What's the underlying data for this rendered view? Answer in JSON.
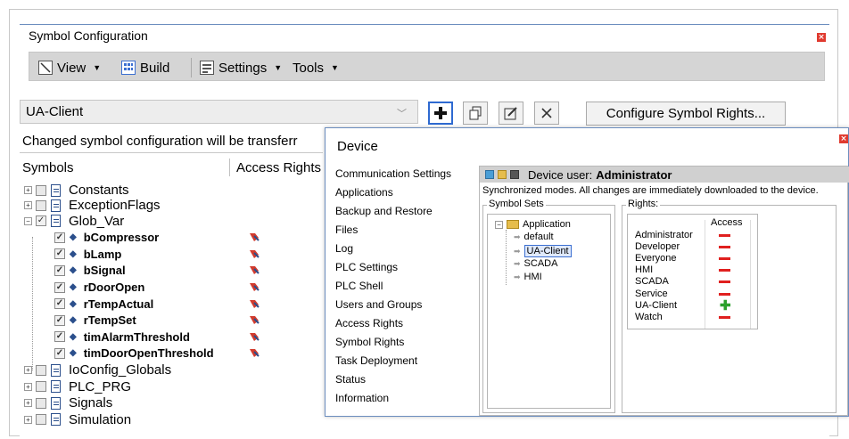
{
  "symbol_config": {
    "title": "Symbol Configuration",
    "toolbar": {
      "view_label": "View",
      "build_label": "Build",
      "settings_label": "Settings",
      "tools_label": "Tools"
    },
    "application_select": {
      "value": "UA-Client"
    },
    "buttons": {
      "configure_rights_label": "Configure Symbol Rights..."
    },
    "info_text": "Changed symbol configuration will be transferr",
    "columns": {
      "symbols": "Symbols",
      "access_rights": "Access Rights"
    },
    "tree": [
      {
        "label": "Constants",
        "level": 0,
        "expanded": false,
        "checked": false
      },
      {
        "label": "ExceptionFlags",
        "level": 0,
        "expanded": false,
        "checked": false
      },
      {
        "label": "Glob_Var",
        "level": 0,
        "expanded": true,
        "checked": true
      },
      {
        "label": "bCompressor",
        "level": 1,
        "checked": true
      },
      {
        "label": "bLamp",
        "level": 1,
        "checked": true
      },
      {
        "label": "bSignal",
        "level": 1,
        "checked": true
      },
      {
        "label": "rDoorOpen",
        "level": 1,
        "checked": true
      },
      {
        "label": "rTempActual",
        "level": 1,
        "checked": true
      },
      {
        "label": "rTempSet",
        "level": 1,
        "checked": true
      },
      {
        "label": "timAlarmThreshold",
        "level": 1,
        "checked": true
      },
      {
        "label": "timDoorOpenThreshold",
        "level": 1,
        "checked": true
      },
      {
        "label": "IoConfig_Globals",
        "level": 0,
        "expanded": false,
        "checked": false
      },
      {
        "label": "PLC_PRG",
        "level": 0,
        "expanded": false,
        "checked": false
      },
      {
        "label": "Signals",
        "level": 0,
        "expanded": false,
        "checked": false
      },
      {
        "label": "Simulation",
        "level": 0,
        "expanded": false,
        "checked": false
      }
    ]
  },
  "device": {
    "title": "Device",
    "nav": [
      "Communication Settings",
      "Applications",
      "Backup and Restore",
      "Files",
      "Log",
      "PLC Settings",
      "PLC Shell",
      "Users and Groups",
      "Access Rights",
      "Symbol Rights",
      "Task Deployment",
      "Status",
      "Information"
    ],
    "user_bar": {
      "prefix": "Device user:",
      "user": "Administrator"
    },
    "sync_text": "Synchronized modes. All changes are immediately downloaded to the device.",
    "symbol_sets": {
      "label": "Symbol Sets",
      "root": "Application",
      "items": [
        "default",
        "UA-Client",
        "SCADA",
        "HMI"
      ],
      "selected": "UA-Client"
    },
    "rights": {
      "label": "Rights:",
      "access_header": "Access",
      "rows": [
        {
          "name": "Administrator",
          "access": "deny"
        },
        {
          "name": "Developer",
          "access": "deny"
        },
        {
          "name": "Everyone",
          "access": "deny"
        },
        {
          "name": "HMI",
          "access": "deny"
        },
        {
          "name": "SCADA",
          "access": "deny"
        },
        {
          "name": "Service",
          "access": "deny"
        },
        {
          "name": "UA-Client",
          "access": "allow"
        },
        {
          "name": "Watch",
          "access": "deny"
        }
      ]
    }
  },
  "colors": {
    "deny": "#e0201f",
    "allow": "#2ca02c",
    "accent": "#2e6ad1",
    "close": "#e03a2f"
  }
}
